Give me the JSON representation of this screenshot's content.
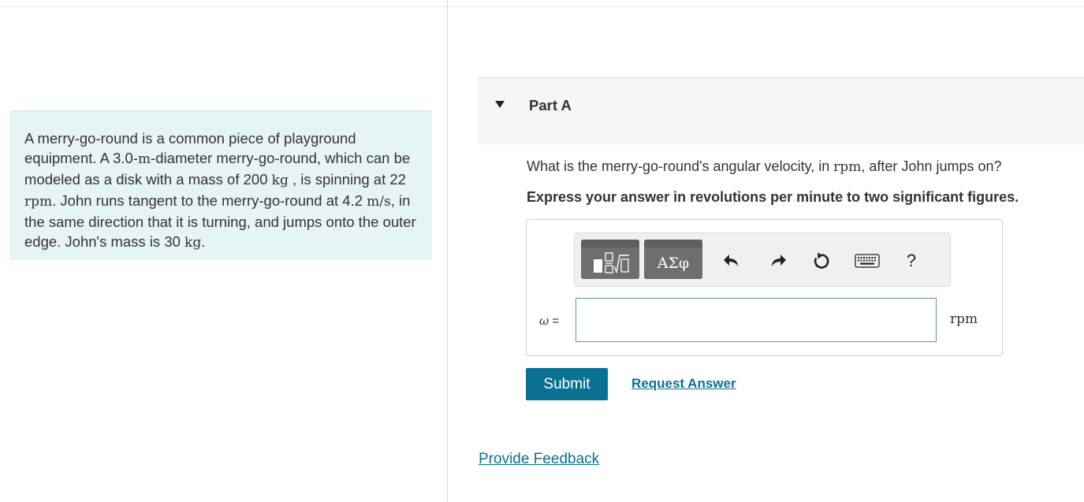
{
  "problem": {
    "t1": "A merry-go-round is a common piece of playground equipment. A 3.0-",
    "m1": "m",
    "t2": "-diameter merry-go-round, which can be modeled as a disk with a mass of 200 ",
    "m2": "kg",
    "t3": " , is spinning at 22 ",
    "m3": "rpm",
    "t4": ". John runs tangent to the merry-go-round at 4.2 ",
    "m4": "m/s",
    "t5": ", in the same direction that it is turning, and jumps onto the outer edge. John's mass is 30 ",
    "m5": "kg",
    "t6": "."
  },
  "part": {
    "title": "Part A"
  },
  "question": {
    "t1": "What is the merry-go-round's angular velocity, in ",
    "m1": "rpm",
    "t2": ", after John jumps on?"
  },
  "instruction": "Express your answer in revolutions per minute to two significant figures.",
  "toolbar": {
    "greek_label": "ΑΣφ",
    "help_label": "?"
  },
  "answer": {
    "variable": "ω",
    "equals": " =",
    "value": "",
    "unit": "rpm"
  },
  "actions": {
    "submit_label": "Submit",
    "request_label": "Request Answer"
  },
  "feedback_label": "Provide Feedback",
  "icons": {
    "part_toggle": "triangle-down-icon",
    "templates": "templates-icon",
    "undo": "undo-icon",
    "redo": "redo-icon",
    "reset": "reset-icon",
    "keyboard": "keyboard-icon",
    "help": "help-icon"
  },
  "colors": {
    "accent": "#0a7193",
    "problem_bg": "#e7f4f5",
    "toolbar_button": "#6e6e6e"
  }
}
